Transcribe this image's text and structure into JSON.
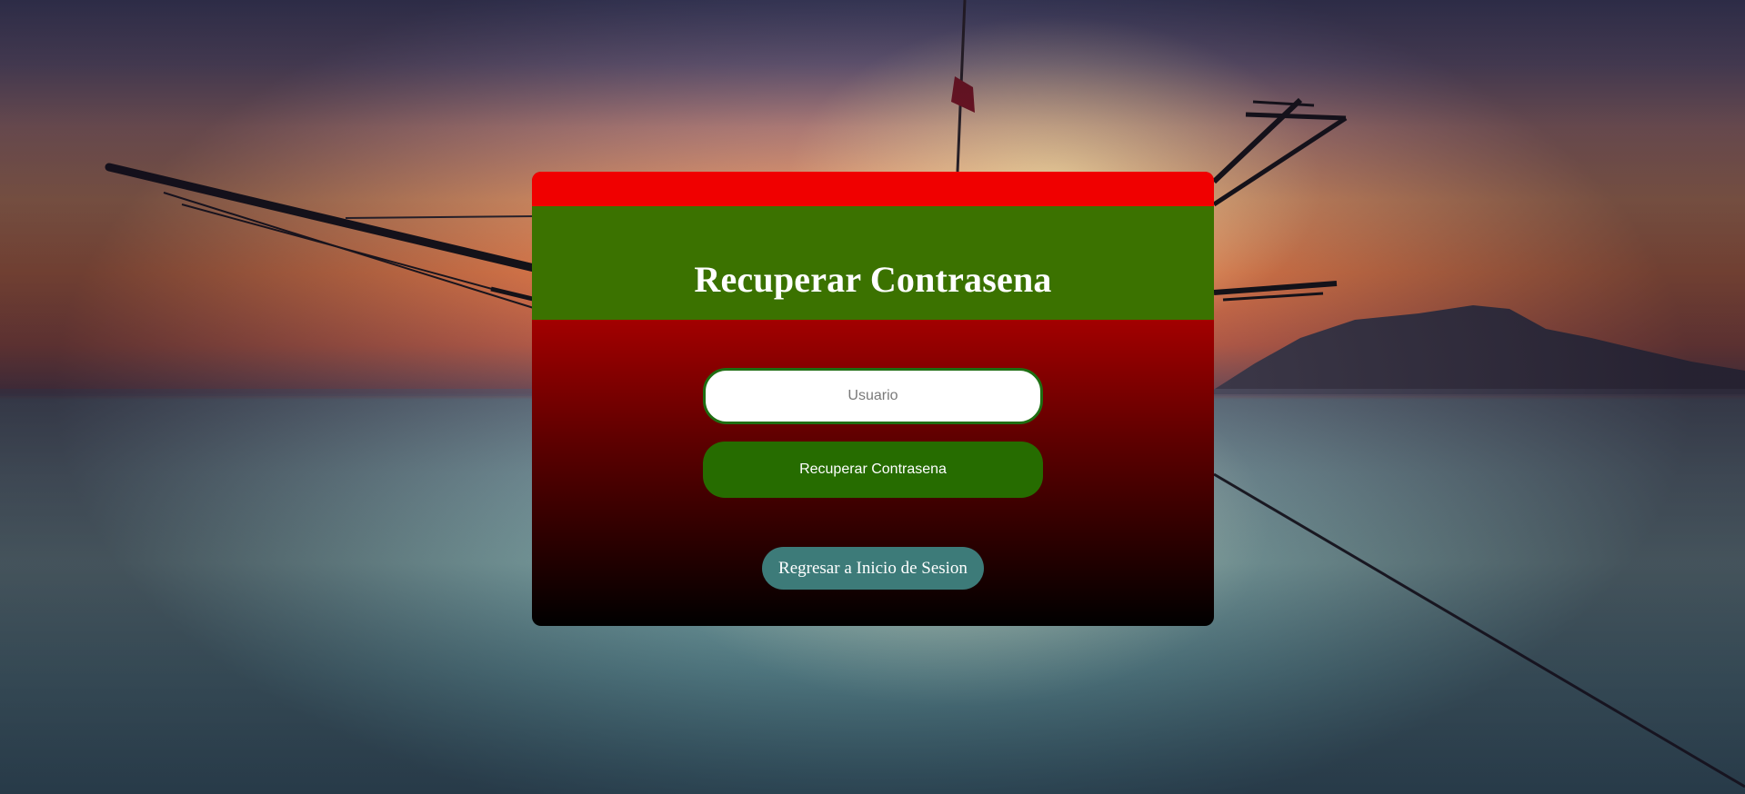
{
  "page": {
    "title": "Recuperar Contrasena"
  },
  "form": {
    "username_placeholder": "Usuario",
    "username_value": "",
    "submit_label": "Recuperar Contrasena",
    "back_label": "Regresar a Inicio de Sesion"
  },
  "colors": {
    "top_bar": "#f00000",
    "header": "#3b7200",
    "card_gradient_start": "#a40000",
    "card_gradient_end": "#000000",
    "submit_button": "#266c00",
    "back_button": "#3d7b79"
  }
}
